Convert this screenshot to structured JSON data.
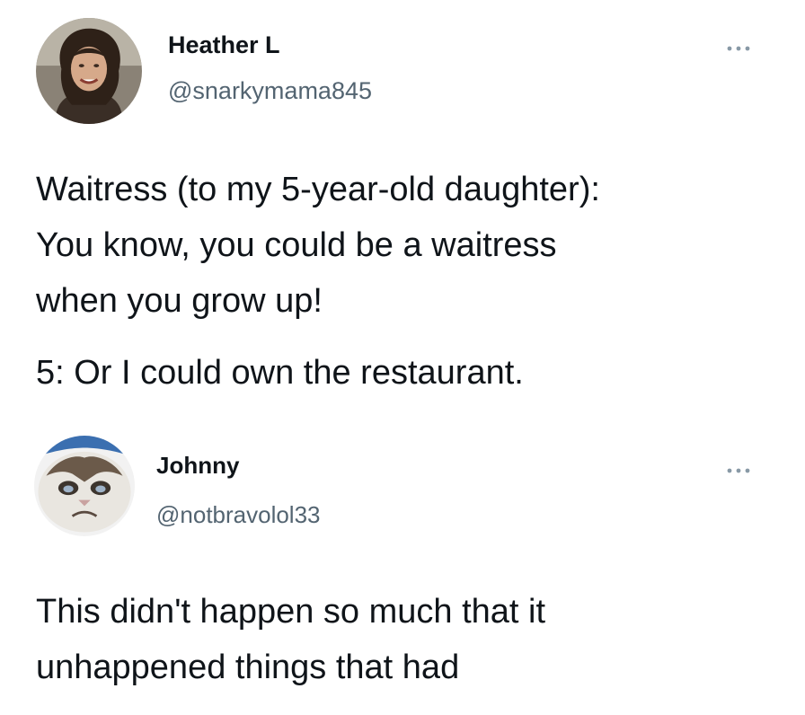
{
  "tweets": [
    {
      "display_name": "Heather L",
      "handle": "@snarkymama845",
      "more_icon": "ellipsis-icon",
      "text_lines": [
        "Waitress (to my 5-year-old daughter):",
        "You know, you could be a waitress",
        "when you grow up!",
        "5: Or I could own the restaurant."
      ]
    },
    {
      "display_name": "Johnny",
      "handle": "@notbravolol33",
      "more_icon": "ellipsis-icon",
      "text_lines": [
        "This didn't happen so much that it",
        "unhappened things that had"
      ]
    }
  ],
  "colors": {
    "name": "#0f1419",
    "handle": "#536471",
    "icon": "#8899a6",
    "background": "#ffffff"
  }
}
